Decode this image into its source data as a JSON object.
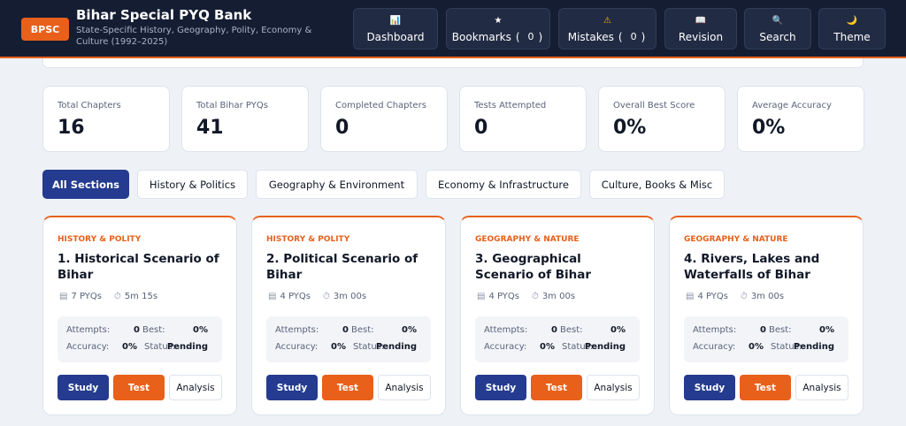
{
  "header": {
    "logo": "BPSC",
    "title": "Bihar Special PYQ Bank",
    "subtitle": "State-Specific History, Geography, Polity, Economy & Culture (1992–2025)",
    "nav": [
      {
        "icon": "📊",
        "label": "Dashboard",
        "icon_name": "chart-icon"
      },
      {
        "icon": "★",
        "label": "Bookmarks",
        "count": "0",
        "icon_name": "star-icon"
      },
      {
        "icon": "⚠",
        "label": "Mistakes",
        "count": "0",
        "icon_name": "warning-icon"
      },
      {
        "icon": "📖",
        "label": "Revision",
        "icon_name": "book-icon"
      },
      {
        "icon": "🔍",
        "label": "Search",
        "icon_name": "search-icon"
      },
      {
        "icon": "🌙",
        "label": "Theme",
        "icon_name": "moon-icon"
      }
    ]
  },
  "stats": [
    {
      "label": "Total Chapters",
      "value": "16"
    },
    {
      "label": "Total Bihar PYQs",
      "value": "41"
    },
    {
      "label": "Completed Chapters",
      "value": "0"
    },
    {
      "label": "Tests Attempted",
      "value": "0"
    },
    {
      "label": "Overall Best Score",
      "value": "0%"
    },
    {
      "label": "Average Accuracy",
      "value": "0%"
    }
  ],
  "tabs": [
    "All Sections",
    "History & Politics",
    "Geography & Environment",
    "Economy & Infrastructure",
    "Culture, Books & Misc"
  ],
  "cards": [
    {
      "category": "HISTORY & POLITY",
      "title": "1. Historical Scenario of Bihar",
      "pyqs": "7 PYQs",
      "time": "5m 15s",
      "attempts": "0",
      "best": "0%",
      "accuracy": "0%",
      "status": "Pending"
    },
    {
      "category": "HISTORY & POLITY",
      "title": "2. Political Scenario of Bihar",
      "pyqs": "4 PYQs",
      "time": "3m 00s",
      "attempts": "0",
      "best": "0%",
      "accuracy": "0%",
      "status": "Pending"
    },
    {
      "category": "GEOGRAPHY & NATURE",
      "title": "3. Geographical Scenario of Bihar",
      "pyqs": "4 PYQs",
      "time": "3m 00s",
      "attempts": "0",
      "best": "0%",
      "accuracy": "0%",
      "status": "Pending"
    },
    {
      "category": "GEOGRAPHY & NATURE",
      "title": "4. Rivers, Lakes and Waterfalls of Bihar",
      "pyqs": "4 PYQs",
      "time": "3m 00s",
      "attempts": "0",
      "best": "0%",
      "accuracy": "0%",
      "status": "Pending"
    }
  ],
  "card_labels": {
    "attempts": "Attempts:",
    "best": "Best:",
    "accuracy": "Accuracy:",
    "status": "Status:",
    "study": "Study",
    "test": "Test",
    "analysis": "Analysis"
  },
  "colors": {
    "accent": "#e8601a",
    "primary": "#243b8f",
    "header_bg": "#151d33"
  }
}
